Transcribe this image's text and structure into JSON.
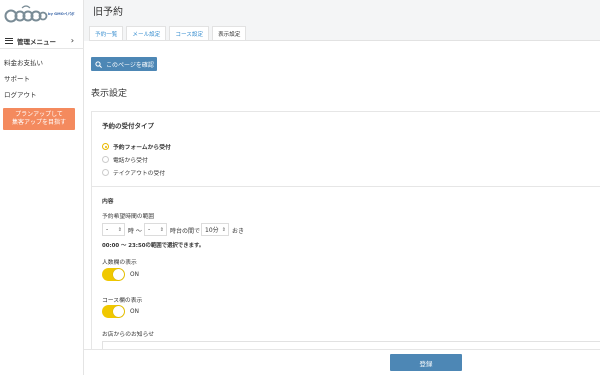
{
  "app": {
    "logo_text": "Goope",
    "logo_sub": "by GMOペパボ"
  },
  "sidebar": {
    "menu_label": "管理メニュー",
    "links": [
      "料金お支払い",
      "サポート",
      "ログアウト"
    ],
    "upgrade_line1": "プランアップして",
    "upgrade_line2": "集客アップを目指す"
  },
  "header": {
    "title": "旧予約",
    "tabs": [
      {
        "label": "予約一覧",
        "active": false
      },
      {
        "label": "メール設定",
        "active": false
      },
      {
        "label": "コース設定",
        "active": false
      },
      {
        "label": "表示設定",
        "active": true
      }
    ]
  },
  "main": {
    "confirm_button": "このページを確認",
    "section_title": "表示設定",
    "reception": {
      "title": "予約の受付タイプ",
      "options": [
        {
          "label": "予約フォームから受付",
          "checked": true
        },
        {
          "label": "電話から受付",
          "checked": false
        },
        {
          "label": "テイクアウトの受付",
          "checked": false
        }
      ]
    },
    "content": {
      "title": "内容",
      "range_label": "予約希望時間の範囲",
      "from_value": "-",
      "from_suffix": "時 〜",
      "to_value": "-",
      "to_suffix": "時台の間で",
      "interval_value": "10分",
      "interval_suffix": "おき",
      "range_note": "00:00 〜 23:50の範囲で選択できます。",
      "people_label": "人数欄の表示",
      "people_toggle": "ON",
      "course_label": "コース欄の表示",
      "course_toggle": "ON",
      "notice_label": "お店からのお知らせ"
    }
  },
  "footer": {
    "register_button": "登録"
  },
  "colors": {
    "accent": "#4d87b5",
    "toggle": "#f0c800",
    "upgrade": "#f48a5e"
  }
}
